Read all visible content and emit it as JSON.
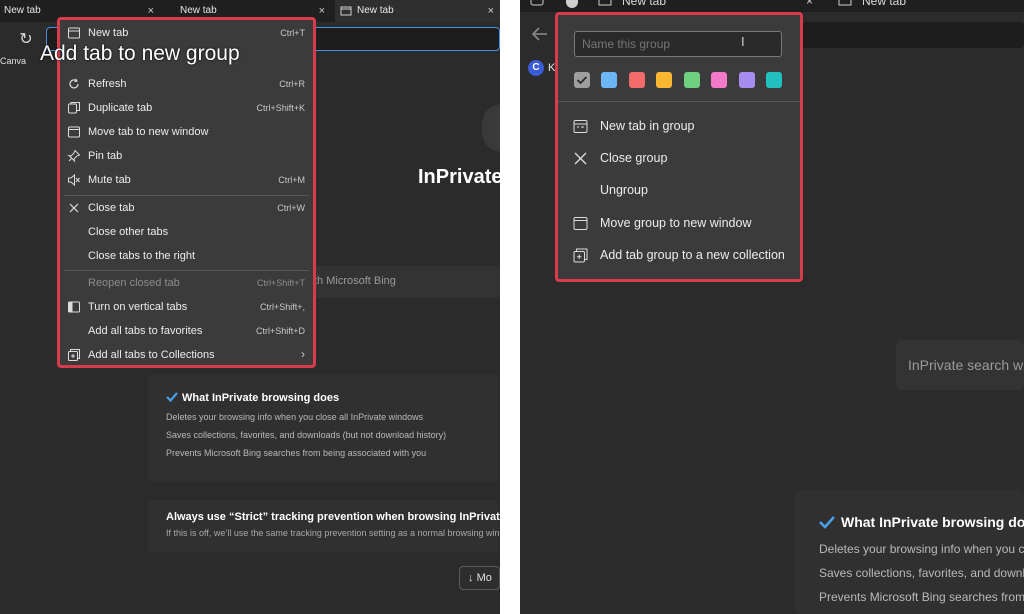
{
  "left": {
    "tabs": [
      {
        "label": "New tab",
        "close": "×"
      },
      {
        "label": "New tab",
        "close": "×"
      },
      {
        "label": "New tab",
        "close": "×"
      }
    ],
    "favorite": "Canva",
    "tooltip": "Add tab to new group",
    "page": {
      "title": "InPrivate",
      "search_placeholder": "th Microsoft Bing",
      "card1_title": "What InPrivate browsing does",
      "card1_lines": [
        "Deletes your browsing info when you close all InPrivate windows",
        "Saves collections, favorites, and downloads (but not download history)",
        "Prevents Microsoft Bing searches from being associated with you"
      ],
      "card2_title": "Always use “Strict” tracking prevention when browsing InPrivate",
      "card2_sub": "If this is off, we’ll use the same tracking prevention setting as a normal browsing window",
      "more_button": "Mo"
    },
    "context_menu": {
      "items": [
        {
          "label": "New tab",
          "shortcut": "Ctrl+T",
          "icon": "new-tab-icon"
        },
        {
          "label": "Refresh",
          "shortcut": "Ctrl+R",
          "icon": "refresh-icon"
        },
        {
          "label": "Duplicate tab",
          "shortcut": "Ctrl+Shift+K",
          "icon": "duplicate-icon"
        },
        {
          "label": "Move tab to new window",
          "shortcut": "",
          "icon": "window-icon"
        },
        {
          "label": "Pin tab",
          "shortcut": "",
          "icon": "pin-icon"
        },
        {
          "label": "Mute tab",
          "shortcut": "Ctrl+M",
          "icon": "mute-icon"
        },
        {
          "label": "Close tab",
          "shortcut": "Ctrl+W",
          "icon": "close-icon"
        },
        {
          "label": "Close other tabs",
          "shortcut": "",
          "icon": ""
        },
        {
          "label": "Close tabs to the right",
          "shortcut": "",
          "icon": ""
        },
        {
          "label": "Reopen closed tab",
          "shortcut": "Ctrl+Shift+T",
          "icon": ""
        },
        {
          "label": "Turn on vertical tabs",
          "shortcut": "Ctrl+Shift+,",
          "icon": "vertical-tabs-icon"
        },
        {
          "label": "Add all tabs to favorites",
          "shortcut": "Ctrl+Shift+D",
          "icon": ""
        },
        {
          "label": "Add all tabs to Collections",
          "shortcut": "›",
          "icon": "collections-icon"
        }
      ]
    }
  },
  "right": {
    "top_tabs": [
      "New tab",
      "New tab"
    ],
    "favorite_initial": "C",
    "favorite_label": "K",
    "search_text": "InPrivate search wi",
    "card_title": "What InPrivate browsing does",
    "card_lines": [
      "Deletes your browsing info when you c",
      "Saves collections, favorites, and downl",
      "Prevents Microsoft Bing searches from"
    ],
    "group_menu": {
      "name_placeholder": "Name this group",
      "colors": [
        "#9e9e9e",
        "#6cb6f5",
        "#f26a6a",
        "#f7b733",
        "#6fd07f",
        "#f27ac9",
        "#a78cf0",
        "#22c0c0"
      ],
      "selected_color_index": 0,
      "items": [
        {
          "label": "New tab in group",
          "icon": "new-tab-icon"
        },
        {
          "label": "Close group",
          "icon": "close-icon"
        },
        {
          "label": "Ungroup",
          "icon": ""
        },
        {
          "label": "Move group to new window",
          "icon": "window-icon"
        },
        {
          "label": "Add tab group to a new collection",
          "icon": "collections-icon"
        }
      ]
    }
  }
}
